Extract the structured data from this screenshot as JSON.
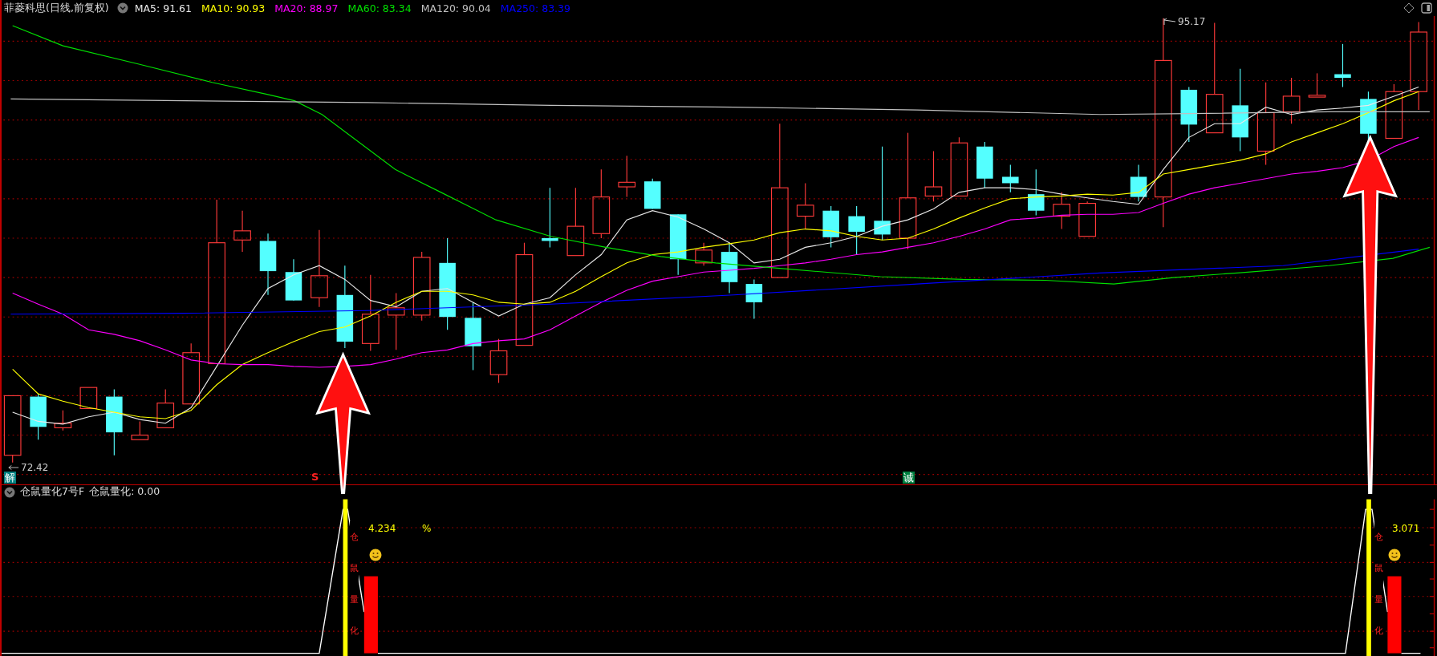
{
  "chart_header": {
    "title": "菲菱科思(日线,前复权)",
    "moving_averages": [
      {
        "label": "MA5: 91.61",
        "color": "#e8e8e8"
      },
      {
        "label": "MA10: 90.93",
        "color": "#ffff00"
      },
      {
        "label": "MA20: 88.97",
        "color": "#ff00ff"
      },
      {
        "label": "MA60: 83.34",
        "color": "#00e000"
      },
      {
        "label": "MA120: 90.04",
        "color": "#c0c0c0"
      },
      {
        "label": "MA250: 83.39",
        "color": "#0000ff"
      }
    ]
  },
  "price_chart": {
    "high_marker": "95.17",
    "low_marker": "72.42",
    "signals": [
      {
        "kind": "badge",
        "text": "解",
        "color": "#008080"
      },
      {
        "kind": "mark",
        "text": "S",
        "color": "#ff2020"
      },
      {
        "kind": "badge",
        "text": "诚",
        "color": "#008040"
      }
    ]
  },
  "indicator": {
    "name": "仓鼠量化7号F",
    "reading": "仓鼠量化: 0.00",
    "signals": [
      {
        "value": "4.234",
        "unit": "%",
        "vertical_text": "仓鼠量化"
      },
      {
        "value": "3.071",
        "vertical_text": "仓鼠量化"
      }
    ]
  }
}
